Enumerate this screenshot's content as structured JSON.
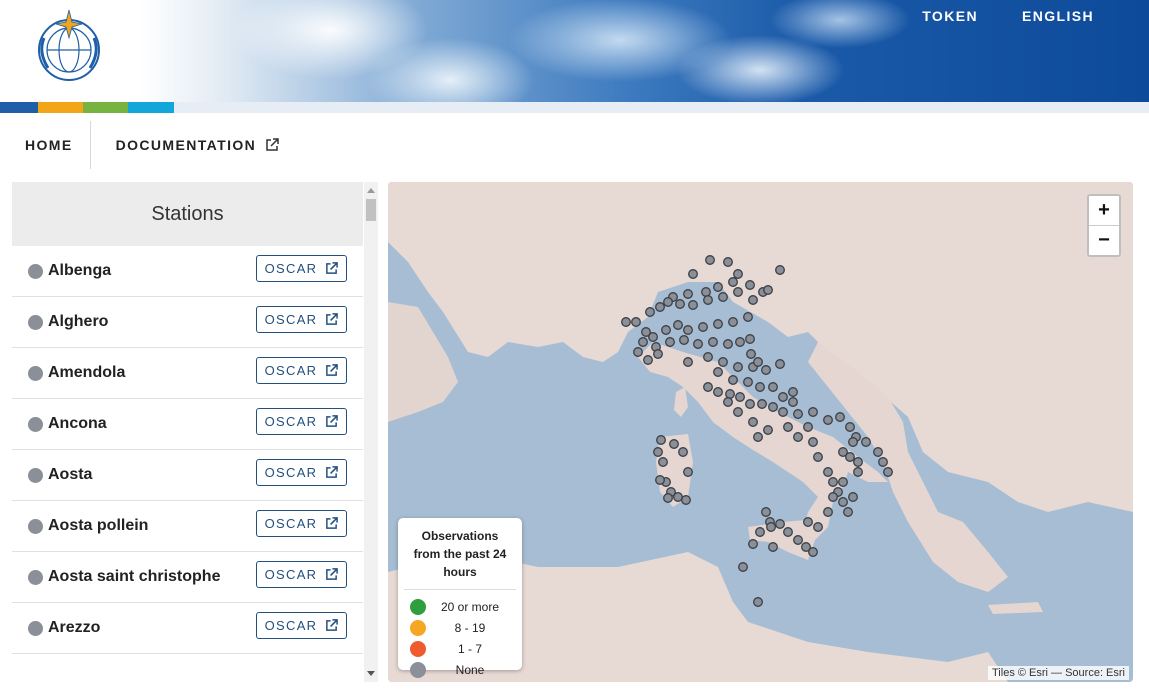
{
  "header": {
    "links": [
      "TOKEN",
      "ENGLISH"
    ],
    "strip_colors": [
      "#1f5fa8",
      "#f2a516",
      "#77b341",
      "#12a7d8"
    ]
  },
  "nav": {
    "home": "HOME",
    "documentation": "DOCUMENTATION"
  },
  "stations_panel": {
    "title": "Stations",
    "button_label": "OSCAR",
    "stations": [
      "Albenga",
      "Alghero",
      "Amendola",
      "Ancona",
      "Aosta",
      "Aosta pollein",
      "Aosta saint christophe",
      "Arezzo"
    ]
  },
  "map": {
    "zoom_in": "+",
    "zoom_out": "−",
    "attribution": "Tiles © Esri — Source: Esri",
    "legend": {
      "title": "Observations from the past 24 hours",
      "items": [
        {
          "label": "20 or more",
          "color": "#2e9e3e"
        },
        {
          "label": "8 - 19",
          "color": "#f5a623"
        },
        {
          "label": "1 - 7",
          "color": "#ef5a2f"
        },
        {
          "label": "None",
          "color": "#8a8f98"
        }
      ]
    },
    "station_marker_color": "#8a8f98"
  }
}
